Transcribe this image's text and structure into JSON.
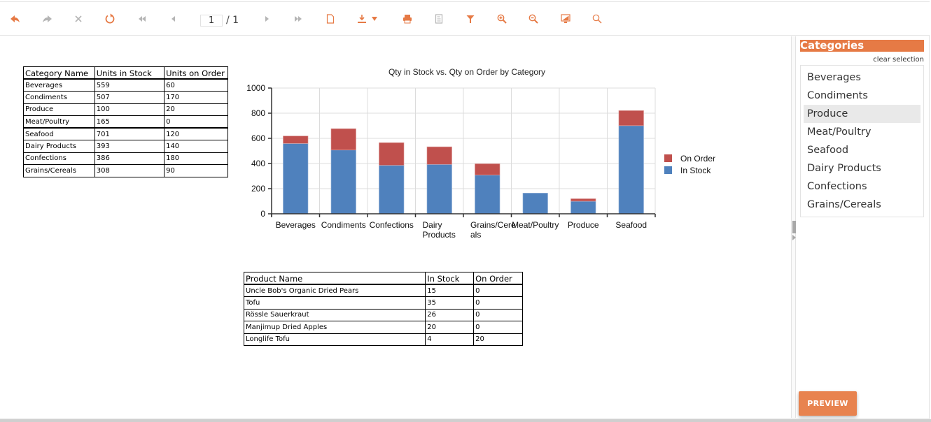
{
  "toolbar": {
    "buttons": [
      {
        "name": "back-button",
        "icon": "back-arrow-icon",
        "enabled": true
      },
      {
        "name": "forward-button",
        "icon": "forward-arrow-icon",
        "enabled": false
      },
      {
        "name": "stop-button",
        "icon": "close-icon",
        "enabled": false
      },
      {
        "name": "refresh-button",
        "icon": "refresh-icon",
        "enabled": true
      },
      {
        "name": "first-page-button",
        "icon": "first-page-icon",
        "enabled": false
      },
      {
        "name": "prev-page-button",
        "icon": "prev-page-icon",
        "enabled": false
      },
      {
        "name": "next-page-button",
        "icon": "next-page-icon",
        "enabled": false
      },
      {
        "name": "last-page-button",
        "icon": "last-page-icon",
        "enabled": false
      },
      {
        "name": "page-setup-button",
        "icon": "document-icon",
        "enabled": true
      },
      {
        "name": "export-button",
        "icon": "download-icon",
        "enabled": true
      },
      {
        "name": "print-button",
        "icon": "printer-icon",
        "enabled": true
      },
      {
        "name": "print-layout-button",
        "icon": "page-layout-icon",
        "enabled": false
      },
      {
        "name": "parameters-button",
        "icon": "filter-icon",
        "enabled": true
      },
      {
        "name": "zoom-in-button",
        "icon": "zoom-in-icon",
        "enabled": true
      },
      {
        "name": "zoom-out-button",
        "icon": "zoom-out-icon",
        "enabled": true
      },
      {
        "name": "fullscreen-button",
        "icon": "monitor-icon",
        "enabled": true
      },
      {
        "name": "search-button",
        "icon": "search-icon",
        "enabled": true
      }
    ],
    "page_current": "1",
    "page_total": "/ 1"
  },
  "colors": {
    "accent": "#e67a45",
    "disabled": "#b5b5b5",
    "in_stock": "#4f81bd",
    "on_order": "#c0504d"
  },
  "category_table": {
    "headers": [
      "Category Name",
      "Units in Stock",
      "Units on Order"
    ],
    "rows": [
      [
        "Beverages",
        "559",
        "60"
      ],
      [
        "Condiments",
        "507",
        "170"
      ],
      [
        "Produce",
        "100",
        "20"
      ],
      [
        "Meat/Poultry",
        "165",
        "0"
      ],
      [
        "Seafood",
        "701",
        "120"
      ],
      [
        "Dairy Products",
        "393",
        "140"
      ],
      [
        "Confections",
        "386",
        "180"
      ],
      [
        "Grains/Cereals",
        "308",
        "90"
      ]
    ]
  },
  "chart_data": {
    "type": "bar",
    "stacked": true,
    "title": "Qty in Stock vs. Qty on Order by Category",
    "xlabel": "",
    "ylabel": "",
    "categories": [
      "Beverages",
      "Condiments",
      "Confections",
      "Dairy Products",
      "Grains/Cereals",
      "Meat/Poultry",
      "Produce",
      "Seafood"
    ],
    "category_label_lines": [
      [
        "Beverages"
      ],
      [
        "Condiments"
      ],
      [
        "Confections"
      ],
      [
        "Dairy",
        "Products"
      ],
      [
        "Grains/Cere",
        "als"
      ],
      [
        "Meat/Poultry"
      ],
      [
        "Produce"
      ],
      [
        "Seafood"
      ]
    ],
    "series": [
      {
        "name": "In Stock",
        "color": "#4f81bd",
        "values": [
          559,
          507,
          386,
          393,
          308,
          165,
          100,
          701
        ]
      },
      {
        "name": "On Order",
        "color": "#c0504d",
        "values": [
          60,
          170,
          180,
          140,
          90,
          0,
          20,
          120
        ]
      }
    ],
    "ylim": [
      0,
      1000
    ],
    "yticks": [
      0,
      200,
      400,
      600,
      800,
      1000
    ],
    "grid": true,
    "legend": {
      "placement": "right",
      "entries": [
        "On Order",
        "In Stock"
      ]
    }
  },
  "product_table": {
    "headers": [
      "Product Name",
      "In Stock",
      "On Order"
    ],
    "rows": [
      [
        "Uncle Bob's Organic Dried Pears",
        "15",
        "0"
      ],
      [
        "Tofu",
        "35",
        "0"
      ],
      [
        "Rössle Sauerkraut",
        "26",
        "0"
      ],
      [
        "Manjimup Dried Apples",
        "20",
        "0"
      ],
      [
        "Longlife Tofu",
        "4",
        "20"
      ]
    ]
  },
  "panel": {
    "title": "Categories",
    "clear_label": "clear selection",
    "items": [
      "Beverages",
      "Condiments",
      "Produce",
      "Meat/Poultry",
      "Seafood",
      "Dairy Products",
      "Confections",
      "Grains/Cereals"
    ],
    "selected": "Produce",
    "preview_label": "PREVIEW"
  }
}
